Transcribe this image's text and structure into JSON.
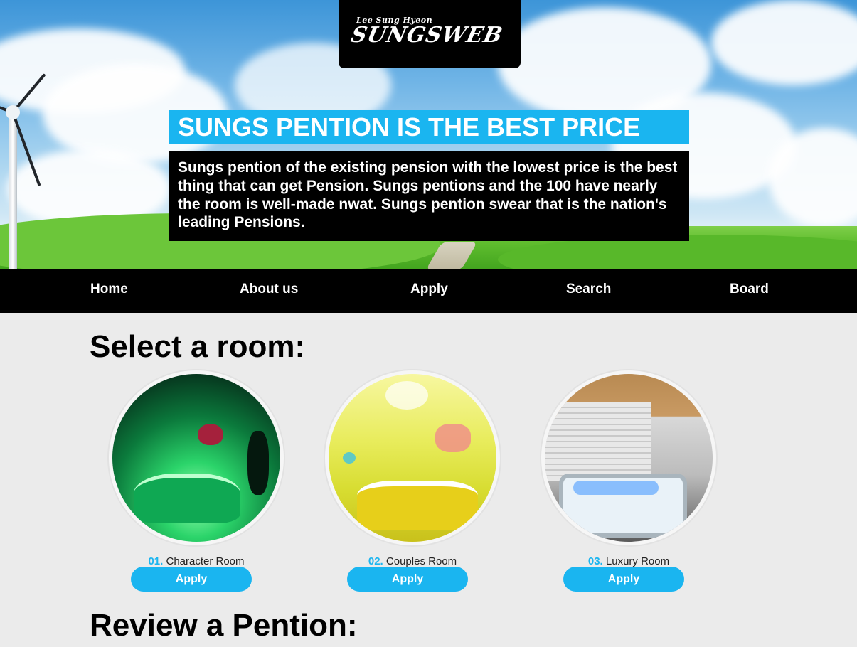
{
  "logo": {
    "subtitle": "Lee Sung Hyeon",
    "title": "SUNGSWEB"
  },
  "hero": {
    "title": "SUNGS PENTION IS THE BEST PRICE",
    "description": "Sungs pention of the existing pension with the lowest price is the best thing that can get Pension. Sungs pentions and the 100 have nearly the room is well-made nwat. Sungs pention swear that is the nation's leading Pensions."
  },
  "nav": {
    "items": [
      {
        "label": "Home"
      },
      {
        "label": "About us"
      },
      {
        "label": "Apply"
      },
      {
        "label": "Search"
      },
      {
        "label": "Board"
      }
    ]
  },
  "main": {
    "select_title": "Select a room:",
    "review_title": "Review a Pention:",
    "rooms": [
      {
        "number": "01.",
        "name": "Character Room",
        "button": "Apply"
      },
      {
        "number": "02.",
        "name": "Couples Room",
        "button": "Apply"
      },
      {
        "number": "03.",
        "name": "Luxury Room",
        "button": "Apply"
      }
    ]
  },
  "colors": {
    "accent": "#1ab5f0",
    "nav_bg": "#000000",
    "page_bg": "#ebebeb"
  }
}
